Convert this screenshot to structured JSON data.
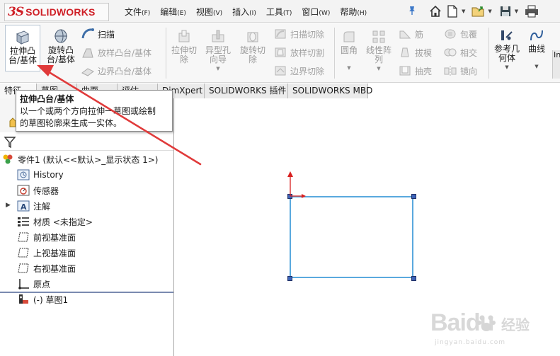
{
  "app": {
    "logo_ds": "3S",
    "logo_text": "SOLIDWORKS"
  },
  "menu": [
    {
      "label": "文件",
      "acc": "(F)"
    },
    {
      "label": "编辑",
      "acc": "(E)"
    },
    {
      "label": "视图",
      "acc": "(V)"
    },
    {
      "label": "插入",
      "acc": "(I)"
    },
    {
      "label": "工具",
      "acc": "(T)"
    },
    {
      "label": "窗口",
      "acc": "(W)"
    },
    {
      "label": "帮助",
      "acc": "(H)"
    }
  ],
  "ribbon": {
    "extrude_boss": "拉伸凸\n台/基体",
    "revolve_boss": "旋转凸\n台/基体",
    "sweep": "扫描",
    "loft_boss": "放样凸台/基体",
    "boundary_boss": "边界凸台/基体",
    "extrude_cut": "拉伸切\n除",
    "hole_wizard": "异型孔\n向导",
    "revolve_cut": "旋转切\n除",
    "swept_cut": "扫描切除",
    "lofted_cut": "放样切割",
    "boundary_cut": "边界切除",
    "fillet": "圆角",
    "linear_pattern": "线性阵\n列",
    "rib": "筋",
    "draft": "拔模",
    "shell": "抽壳",
    "wrap": "包覆",
    "intersect": "相交",
    "mirror": "镜向",
    "ref_geometry": "参考几\n何体",
    "curves": "曲线",
    "cut_edge": "In"
  },
  "tabs": [
    {
      "label": "特征"
    },
    {
      "label": "草图"
    },
    {
      "label": "曲面"
    },
    {
      "label": "评估"
    },
    {
      "label": "DimXpert"
    },
    {
      "label": "SOLIDWORKS 插件"
    },
    {
      "label": "SOLIDWORKS MBD"
    }
  ],
  "tooltip": {
    "title": "拉伸凸台/基体",
    "line1": "以一个或两个方向拉伸一草图或绘制",
    "line2": "的草图轮廓来生成一实体。"
  },
  "tree": {
    "root": "零件1 (默认<<默认>_显示状态 1>)",
    "items": [
      {
        "label": "History",
        "icon": "history-icon"
      },
      {
        "label": "传感器",
        "icon": "sensor-icon"
      },
      {
        "label": "注解",
        "icon": "annotation-icon"
      },
      {
        "label": "材质 <未指定>",
        "icon": "material-icon"
      },
      {
        "label": "前视基准面",
        "icon": "plane-icon"
      },
      {
        "label": "上视基准面",
        "icon": "plane-icon"
      },
      {
        "label": "右视基准面",
        "icon": "plane-icon"
      },
      {
        "label": "原点",
        "icon": "origin-icon"
      },
      {
        "label": "(-) 草图1",
        "icon": "sketch-icon"
      }
    ]
  },
  "watermark": {
    "brand": "Baidu",
    "cn": "经验",
    "url": "jingyan.baidu.com"
  },
  "colors": {
    "brand_red": "#cf2027",
    "sketch_line": "#5aa9de",
    "arrow_red": "#e03a3a"
  }
}
